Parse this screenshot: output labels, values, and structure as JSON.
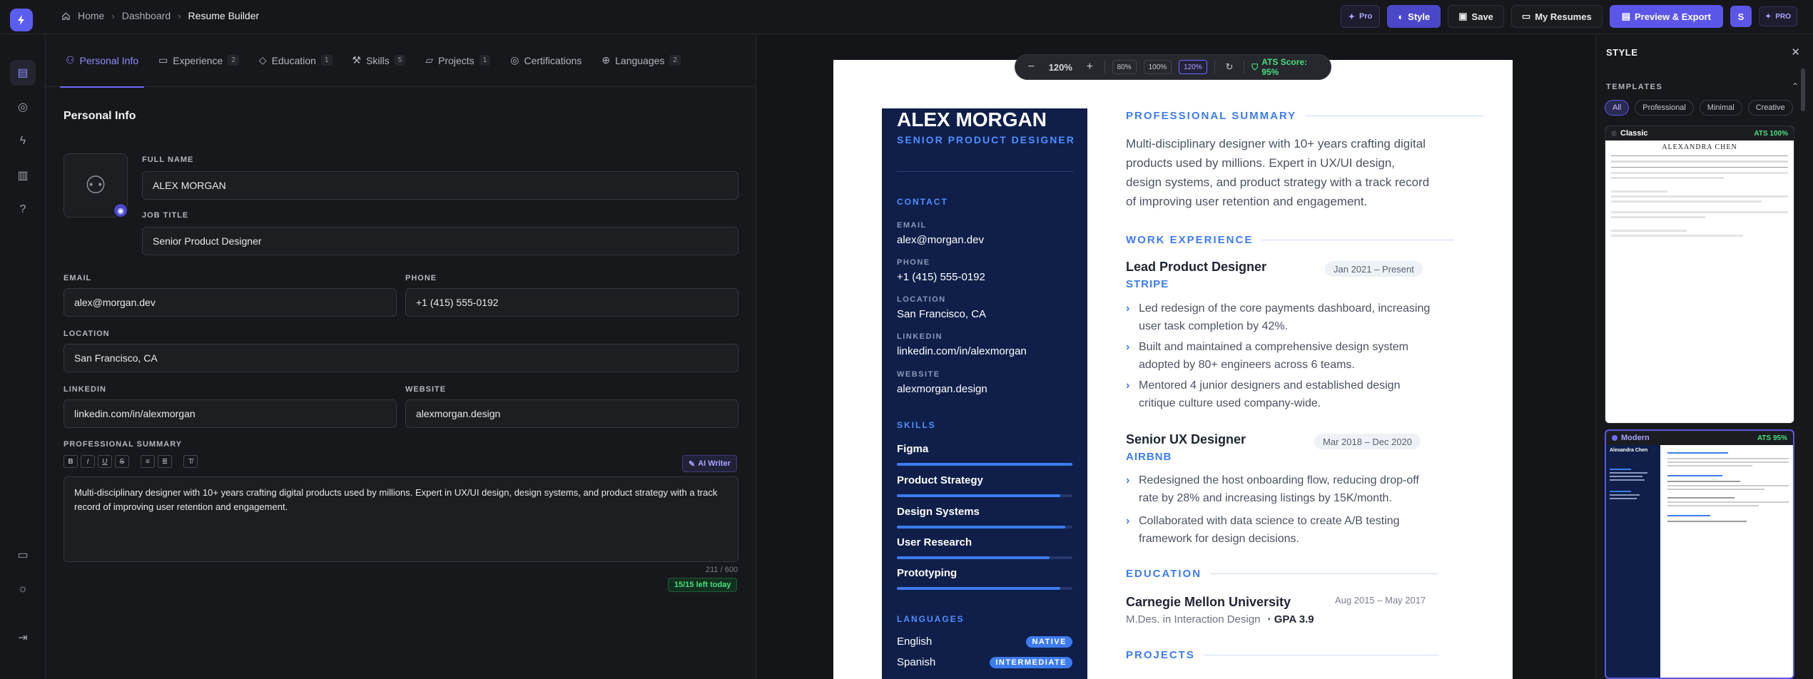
{
  "topbar": {
    "breadcrumbs": [
      "Home",
      "Dashboard",
      "Resume Builder"
    ],
    "pro_label": "Pro",
    "style_label": "Style",
    "save_label": "Save",
    "my_resumes_label": "My Resumes",
    "preview_export_label": "Preview & Export",
    "avatar_initial": "S",
    "plan_badge": "PRO"
  },
  "editor": {
    "tabs": [
      {
        "label": "Personal Info",
        "count": ""
      },
      {
        "label": "Experience",
        "count": "2"
      },
      {
        "label": "Education",
        "count": "1"
      },
      {
        "label": "Skills",
        "count": "5"
      },
      {
        "label": "Projects",
        "count": "1"
      },
      {
        "label": "Certifications",
        "count": ""
      },
      {
        "label": "Languages",
        "count": "2"
      }
    ],
    "section_title": "Personal Info",
    "fields": {
      "full_name": {
        "label": "FULL NAME",
        "value": "ALEX MORGAN"
      },
      "job_title": {
        "label": "JOB TITLE",
        "value": "Senior Product Designer"
      },
      "email": {
        "label": "EMAIL",
        "value": "alex@morgan.dev"
      },
      "phone": {
        "label": "PHONE",
        "value": "+1 (415) 555-0192"
      },
      "location": {
        "label": "LOCATION",
        "value": "San Francisco, CA"
      },
      "linkedin": {
        "label": "LINKEDIN",
        "value": "linkedin.com/in/alexmorgan"
      },
      "website": {
        "label": "WEBSITE",
        "value": "alexmorgan.design"
      }
    },
    "summary": {
      "label": "PROFESSIONAL SUMMARY",
      "ai_label": "AI Writer",
      "text": "Multi-disciplinary designer with 10+ years crafting digital products used by millions. Expert in UX/UI design, design systems, and product strategy with a track record of improving user retention and engagement.",
      "counter": "211 / 600",
      "quota": "15/15 left today"
    }
  },
  "zoom": {
    "value": "120%",
    "presets": [
      "80%",
      "100%",
      "120%"
    ],
    "ats": "ATS Score: 95%"
  },
  "resume": {
    "name": "ALEX MORGAN",
    "title": "SENIOR PRODUCT DESIGNER",
    "contact_head": "CONTACT",
    "contact": [
      {
        "k": "EMAIL",
        "v": "alex@morgan.dev"
      },
      {
        "k": "PHONE",
        "v": "+1 (415) 555-0192"
      },
      {
        "k": "LOCATION",
        "v": "San Francisco, CA"
      },
      {
        "k": "LINKEDIN",
        "v": "linkedin.com/in/alexmorgan"
      },
      {
        "k": "WEBSITE",
        "v": "alexmorgan.design"
      }
    ],
    "skills_head": "SKILLS",
    "skills": [
      {
        "name": "Figma",
        "level": 1.0
      },
      {
        "name": "Product Strategy",
        "level": 0.93
      },
      {
        "name": "Design Systems",
        "level": 0.96
      },
      {
        "name": "User Research",
        "level": 0.87
      },
      {
        "name": "Prototyping",
        "level": 0.93
      }
    ],
    "languages_head": "LANGUAGES",
    "languages": [
      {
        "name": "English",
        "level": "NATIVE"
      },
      {
        "name": "Spanish",
        "level": "INTERMEDIATE"
      }
    ],
    "summary_head": "PROFESSIONAL SUMMARY",
    "summary": "Multi-disciplinary designer with 10+ years crafting digital products used by millions. Expert in UX/UI design, design systems, and product strategy with a track record of improving user retention and engagement.",
    "experience_head": "WORK EXPERIENCE",
    "jobs": [
      {
        "title": "Lead Product Designer",
        "company": "STRIPE",
        "dates": "Jan 2021 – Present",
        "bullets": [
          "Led redesign of the core payments dashboard, increasing user task completion by 42%.",
          "Built and maintained a comprehensive design system adopted by 80+ engineers across 6 teams.",
          "Mentored 4 junior designers and established design critique culture used company-wide."
        ]
      },
      {
        "title": "Senior UX Designer",
        "company": "AIRBNB",
        "dates": "Mar 2018 – Dec 2020",
        "bullets": [
          "Redesigned the host onboarding flow, reducing drop-off rate by 28% and increasing listings by 15K/month.",
          "Collaborated with data science to create A/B testing framework for design decisions."
        ]
      }
    ],
    "education_head": "EDUCATION",
    "education": {
      "school": "Carnegie Mellon University",
      "degree": "M.Des. in Interaction Design",
      "gpa": "· GPA 3.9",
      "dates": "Aug 2015 – May 2017"
    },
    "projects_head": "PROJECTS"
  },
  "style_panel": {
    "title": "STYLE",
    "templates_head": "TEMPLATES",
    "filters": [
      "All",
      "Professional",
      "Minimal",
      "Creative"
    ],
    "templates": [
      {
        "name": "Classic",
        "score": "ATS 100%",
        "preview_name": "ALEXANDRA CHEN"
      },
      {
        "name": "Modern",
        "score": "ATS 95%",
        "preview_name": "Alexandra Chen"
      }
    ]
  }
}
